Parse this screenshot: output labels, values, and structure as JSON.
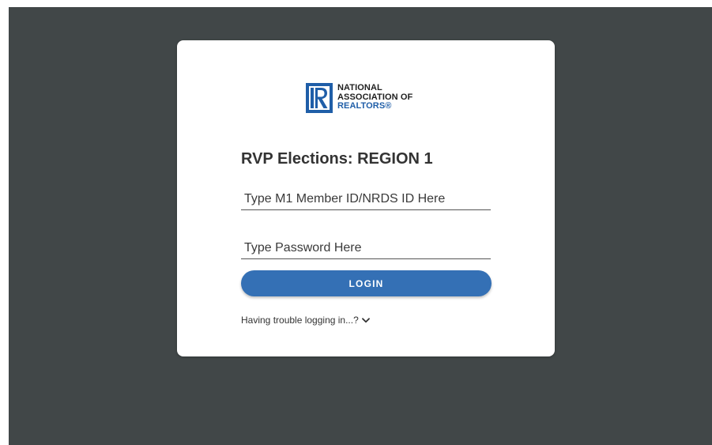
{
  "logo": {
    "line1": "NATIONAL",
    "line2": "ASSOCIATION OF",
    "line3": "REALTORS®",
    "icon": "realtor-r-logo-icon"
  },
  "login": {
    "title": "RVP Elections: REGION 1",
    "member_id_placeholder": "Type M1 Member ID/NRDS ID Here",
    "member_id_value": "",
    "password_placeholder": "Type Password Here",
    "password_value": "",
    "button_label": "LOGIN",
    "trouble_text": "Having trouble logging in...?",
    "trouble_icon": "chevron-down-icon"
  },
  "colors": {
    "backdrop": "#414748",
    "card": "#ffffff",
    "accent": "#3470b5",
    "logo_blue": "#1f5ea8"
  }
}
